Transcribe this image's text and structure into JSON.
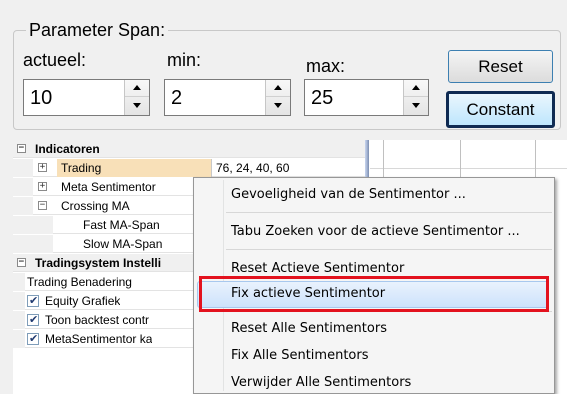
{
  "parameter_span": {
    "title": "Parameter Span:",
    "actueel": {
      "label": "actueel:",
      "value": "10"
    },
    "min": {
      "label": "min:",
      "value": "2"
    },
    "max": {
      "label": "max:",
      "value": "25"
    },
    "reset_label": "Reset",
    "constant_label": "Constant"
  },
  "tree": {
    "rows": [
      {
        "label": "Indicatoren",
        "value": "",
        "type": "header"
      },
      {
        "label": "Trading",
        "value": "76, 24, 40, 60",
        "type": "expandable",
        "selected": true
      },
      {
        "label": "Meta Sentimentor",
        "value": "",
        "type": "expandable"
      },
      {
        "label": "Crossing MA",
        "value": "",
        "type": "collapsible"
      },
      {
        "label": "Fast MA-Span",
        "value": "",
        "type": "child"
      },
      {
        "label": "Slow MA-Span",
        "value": "",
        "type": "child"
      },
      {
        "label": "Tradingsystem Instelli",
        "value": "",
        "type": "header"
      },
      {
        "label": "Trading Benadering",
        "value": "",
        "type": "plain"
      },
      {
        "label": "Equity Grafiek",
        "value": "",
        "type": "checkbox",
        "checked": true
      },
      {
        "label": "Toon backtest contr",
        "value": "",
        "type": "checkbox",
        "checked": true
      },
      {
        "label": "MetaSentimentor ka",
        "value": "",
        "type": "checkbox",
        "checked": true
      }
    ]
  },
  "context_menu": {
    "items": [
      "Gevoeligheid van de Sentimentor ...",
      "Tabu Zoeken voor de actieve Sentimentor ...",
      "Reset Actieve Sentimentor",
      "Fix actieve Sentimentor",
      "Reset Alle Sentimentors",
      "Fix Alle Sentimentors",
      "Verwijder Alle Sentimentors"
    ],
    "hovered": "Fix actieve Sentimentor"
  },
  "icons": {
    "expand": "plus-expander-icon",
    "collapse": "minus-expander-icon",
    "check": "checkmark-icon",
    "spin_up": "triangle-up-icon",
    "spin_down": "triangle-down-icon"
  },
  "colors": {
    "highlight_annotation": "#e3121e",
    "selected_row": "#f8e0b8",
    "menu_hover": "#cde2fb",
    "constant_button_border": "#0f2a52"
  }
}
